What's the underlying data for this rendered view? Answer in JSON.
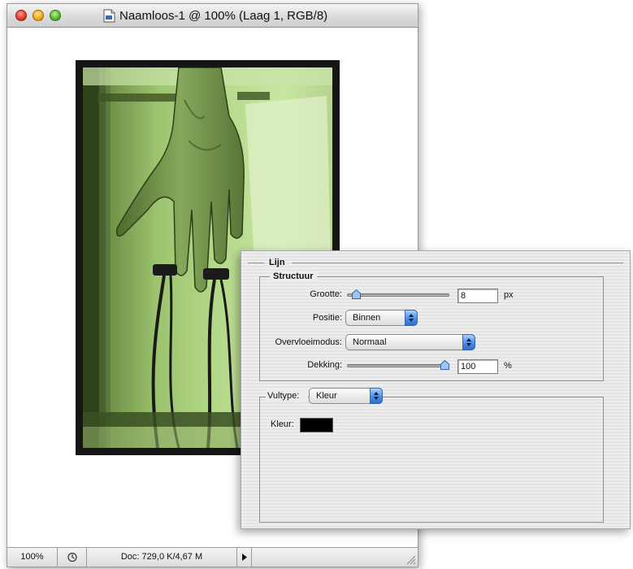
{
  "document_window": {
    "title": "Naamloos-1 @ 100% (Laag 1, RGB/8)",
    "status": {
      "zoom": "100%",
      "doc_size": "Doc: 729,0 K/4,67 M"
    }
  },
  "stroke_dialog": {
    "section_title": "Lijn",
    "structure": {
      "title": "Structuur",
      "size_label": "Grootte:",
      "size_value": "8",
      "size_unit": "px",
      "size_slider_fraction": 0.05,
      "position_label": "Positie:",
      "position_value": "Binnen",
      "blend_mode_label": "Overvloeimodus:",
      "blend_mode_value": "Normaal",
      "opacity_label": "Dekking:",
      "opacity_value": "100",
      "opacity_unit": "%",
      "opacity_slider_fraction": 1.0
    },
    "fill": {
      "type_label": "Vultype:",
      "type_value": "Kleur",
      "color_label": "Kleur:",
      "color_value": "#000000"
    }
  },
  "colors": {
    "accent_blue": "#4a8ee6",
    "photo_tint": "#a8d07c"
  }
}
